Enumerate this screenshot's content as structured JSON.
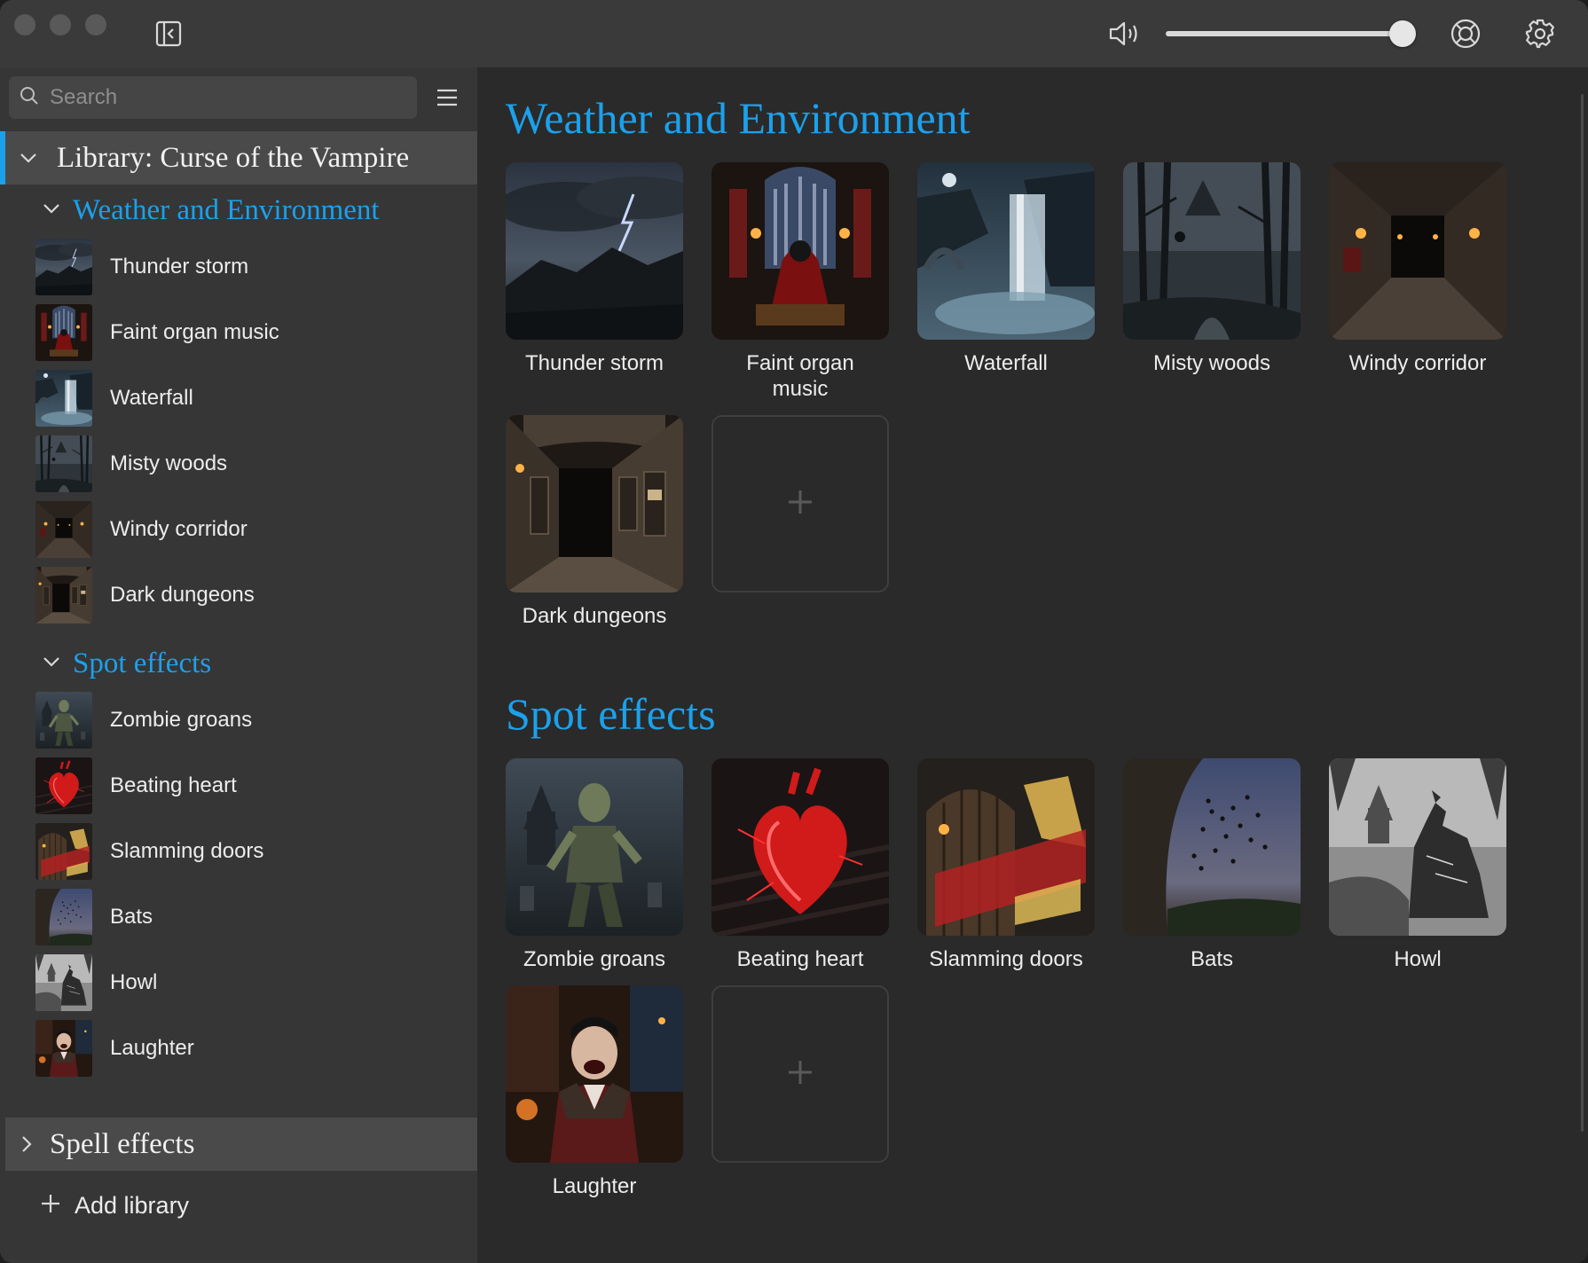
{
  "window": {
    "title_controls": [
      "close",
      "minimize",
      "zoom"
    ]
  },
  "toolbar": {
    "sidebar_toggle_icon": "sidebar-toggle-icon",
    "volume_icon": "speaker-icon",
    "volume_level": 0.97,
    "help_icon": "lifebuoy-icon",
    "settings_icon": "gear-icon"
  },
  "search": {
    "placeholder": "Search",
    "value": ""
  },
  "library": {
    "title": "Library: Curse of the Vampire",
    "groups": [
      {
        "title": "Weather and Environment",
        "items": [
          "Thunder storm",
          "Faint organ music",
          "Waterfall",
          "Misty woods",
          "Windy corridor",
          "Dark dungeons"
        ]
      },
      {
        "title": "Spot effects",
        "items": [
          "Zombie groans",
          "Beating heart",
          "Slamming doors",
          "Bats",
          "Howl",
          "Laughter"
        ]
      }
    ]
  },
  "collapsed_library": {
    "title": "Spell effects"
  },
  "add_library": {
    "label": "Add library"
  },
  "main": {
    "sections": [
      {
        "title": "Weather and Environment",
        "tiles": [
          "Thunder storm",
          "Faint organ music",
          "Waterfall",
          "Misty woods",
          "Windy corridor",
          "Dark dungeons"
        ]
      },
      {
        "title": "Spot effects",
        "tiles": [
          "Zombie groans",
          "Beating heart",
          "Slamming doors",
          "Bats",
          "Howl",
          "Laughter"
        ]
      }
    ]
  },
  "colors": {
    "accent": "#1ba1ec",
    "sidebar_bg": "#363636",
    "main_bg": "#2a2a2a",
    "titlebar_bg": "#3a3a3a"
  }
}
